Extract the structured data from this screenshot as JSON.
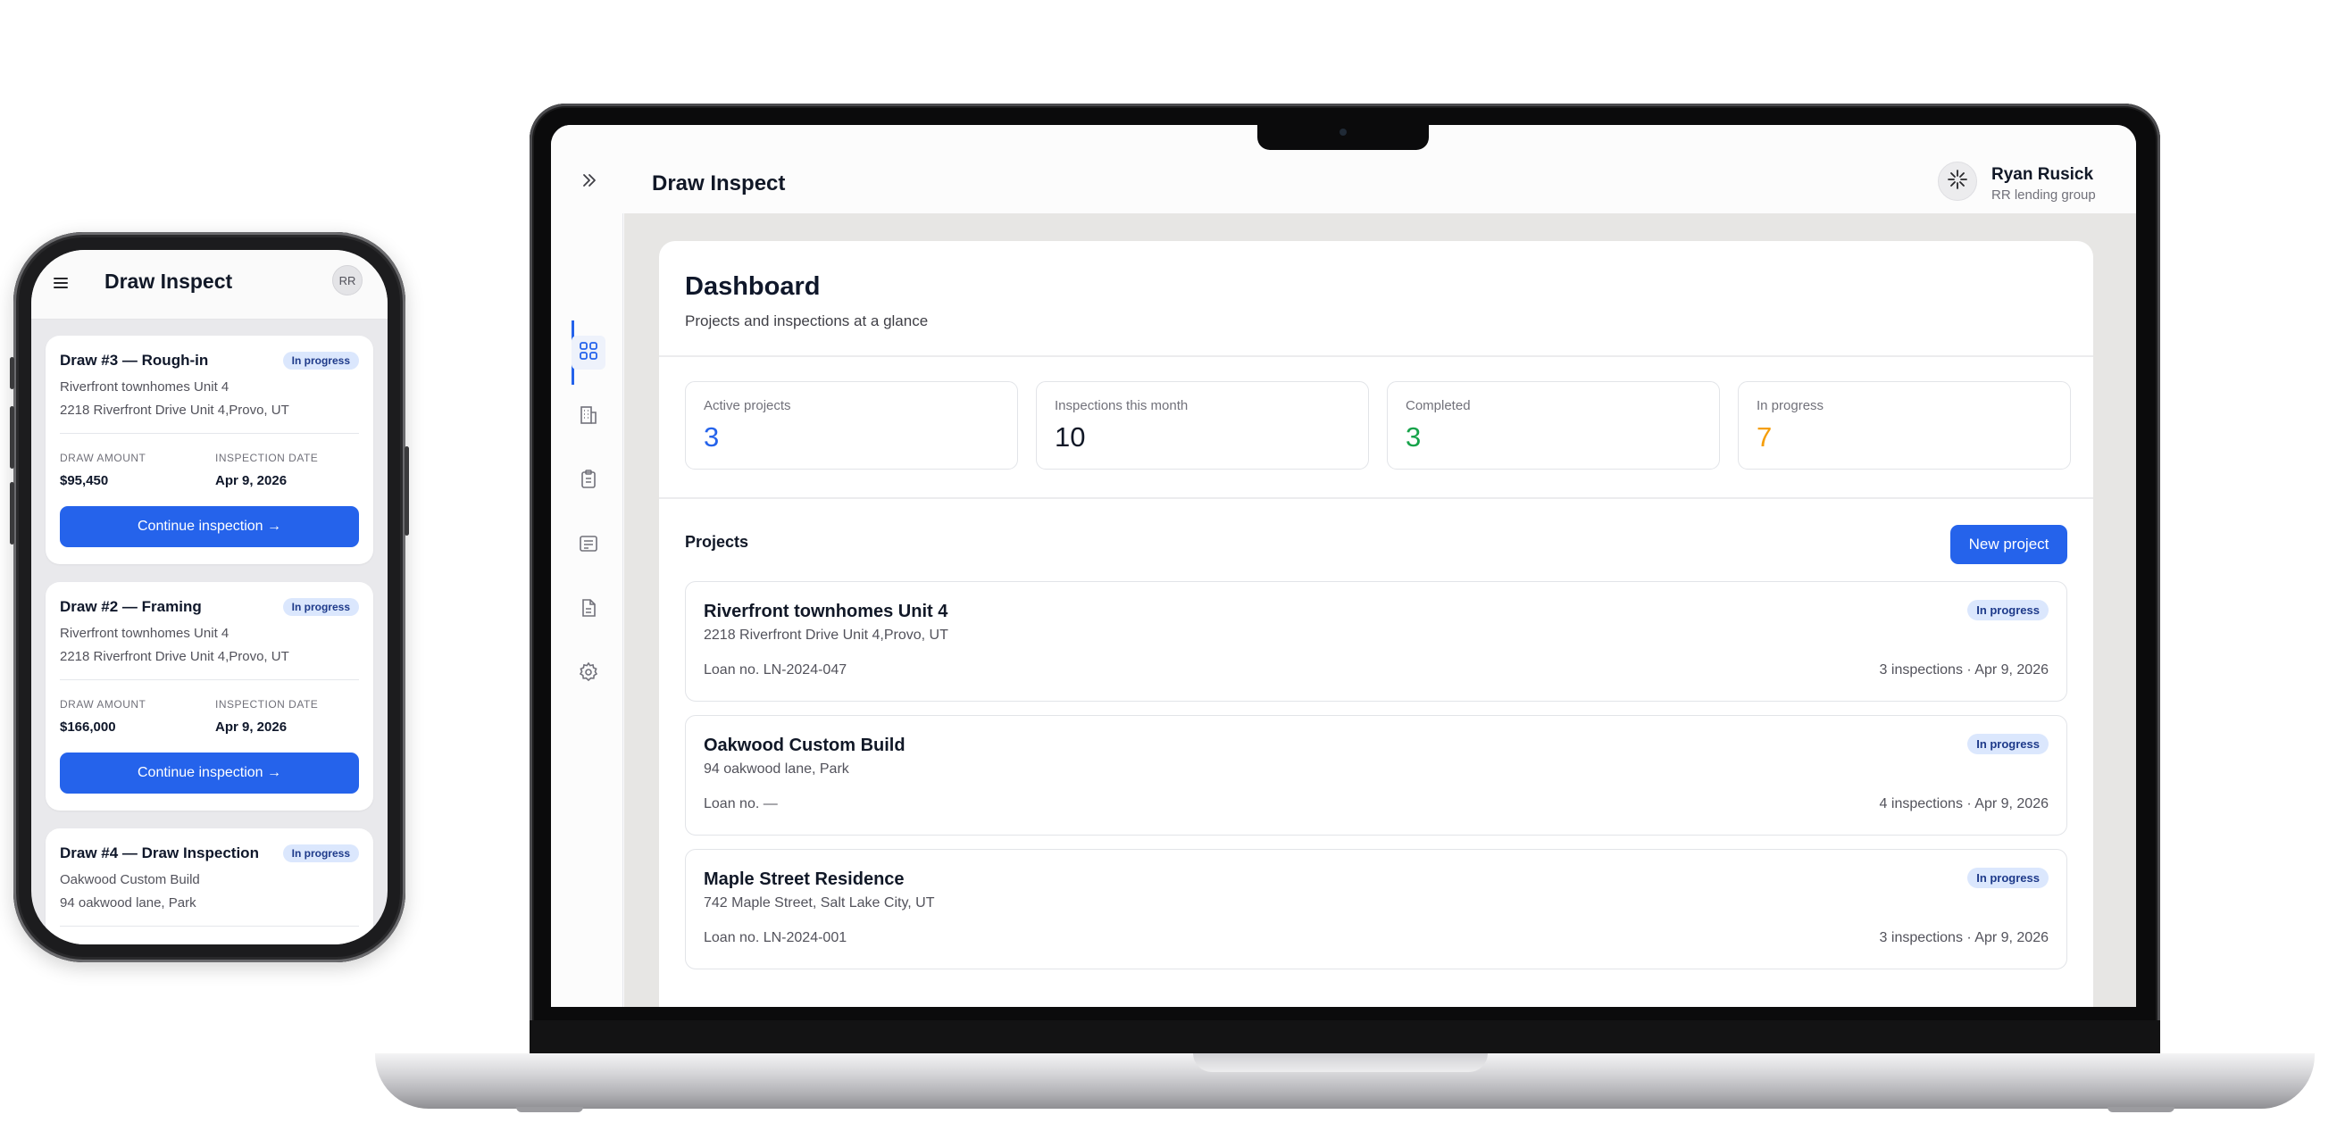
{
  "mobile": {
    "app_title": "Draw Inspect",
    "avatar_initials": "RR",
    "draws": [
      {
        "title": "Draw #3 — Rough-in",
        "status": "In progress",
        "project": "Riverfront townhomes Unit 4",
        "address": "2218 Riverfront Drive Unit 4,Provo, UT",
        "amount_label": "DRAW AMOUNT",
        "amount": "$95,450",
        "date_label": "INSPECTION DATE",
        "date": "Apr 9, 2026",
        "action": "Continue inspection →"
      },
      {
        "title": "Draw #2 — Framing",
        "status": "In progress",
        "project": "Riverfront townhomes Unit 4",
        "address": "2218 Riverfront Drive Unit 4,Provo, UT",
        "amount_label": "DRAW AMOUNT",
        "amount": "$166,000",
        "date_label": "INSPECTION DATE",
        "date": "Apr 9, 2026",
        "action": "Continue inspection →"
      },
      {
        "title": "Draw #4 — Draw Inspection",
        "status": "In progress",
        "project": "Oakwood Custom Build",
        "address": "94 oakwood lane, Park"
      }
    ]
  },
  "desktop": {
    "app_title": "Draw Inspect",
    "user": {
      "name": "Ryan Rusick",
      "org": "RR lending group"
    },
    "sidebar_icons": [
      "dashboard-icon",
      "building-icon",
      "clipboard-icon",
      "list-icon",
      "document-icon",
      "settings-icon"
    ],
    "dashboard": {
      "title": "Dashboard",
      "subtitle": "Projects and inspections at a glance",
      "stats": [
        {
          "label": "Active projects",
          "value": "3",
          "color": "#2563eb"
        },
        {
          "label": "Inspections this month",
          "value": "10",
          "color": "#111827"
        },
        {
          "label": "Completed",
          "value": "3",
          "color": "#16a34a"
        },
        {
          "label": "In progress",
          "value": "7",
          "color": "#f59e0b"
        }
      ],
      "projects_heading": "Projects",
      "new_project_label": "New project",
      "projects": [
        {
          "name": "Riverfront townhomes Unit 4",
          "address": "2218 Riverfront Drive Unit 4,Provo, UT",
          "loan": "Loan no. LN-2024-047",
          "meta": "3 inspections · Apr 9, 2026",
          "status": "In progress"
        },
        {
          "name": "Oakwood Custom Build",
          "address": "94 oakwood lane, Park",
          "loan": "Loan no. —",
          "meta": "4 inspections · Apr 9, 2026",
          "status": "In progress"
        },
        {
          "name": "Maple Street Residence",
          "address": "742 Maple Street, Salt Lake City, UT",
          "loan": "Loan no. LN-2024-001",
          "meta": "3 inspections · Apr 9, 2026",
          "status": "In progress"
        }
      ]
    }
  },
  "colors": {
    "primary": "#2563eb",
    "badge_bg": "#dbe7fd",
    "badge_text": "#1e3a8a"
  }
}
